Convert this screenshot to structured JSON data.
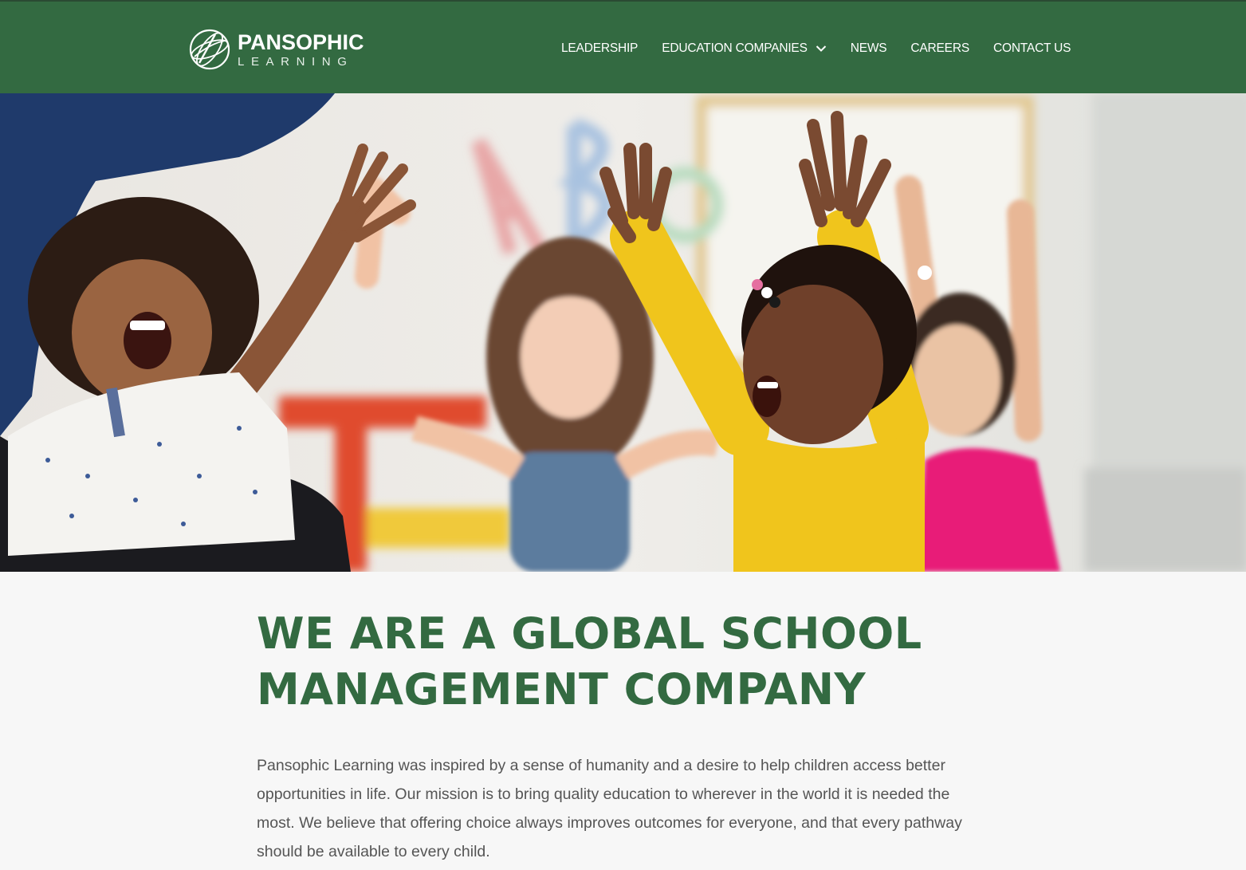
{
  "header": {
    "logo": {
      "icon": "globe-icon",
      "name": "PANSOPHIC",
      "sub": "LEARNING"
    },
    "nav": [
      {
        "label": "LEADERSHIP"
      },
      {
        "label": "EDUCATION COMPANIES",
        "icon": "chevron-down-icon"
      },
      {
        "label": "NEWS"
      },
      {
        "label": "CAREERS"
      },
      {
        "label": "CONTACT US"
      }
    ],
    "colors": {
      "brand_green": "#336a41",
      "text_white": "#ffffff"
    }
  },
  "hero": {
    "image": "children raising hands in classroom"
  },
  "main": {
    "headline_line1": "WE ARE A GLOBAL SCHOOL",
    "headline_line2": "MANAGEMENT COMPANY",
    "paragraph": "Pansophic Learning was inspired by a sense of humanity and a desire to help children access better opportunities in life. Our mission is to bring quality education to wherever in the world it is needed the most. We believe that offering choice always improves outcomes for everyone, and that every pathway should be available to every child."
  }
}
